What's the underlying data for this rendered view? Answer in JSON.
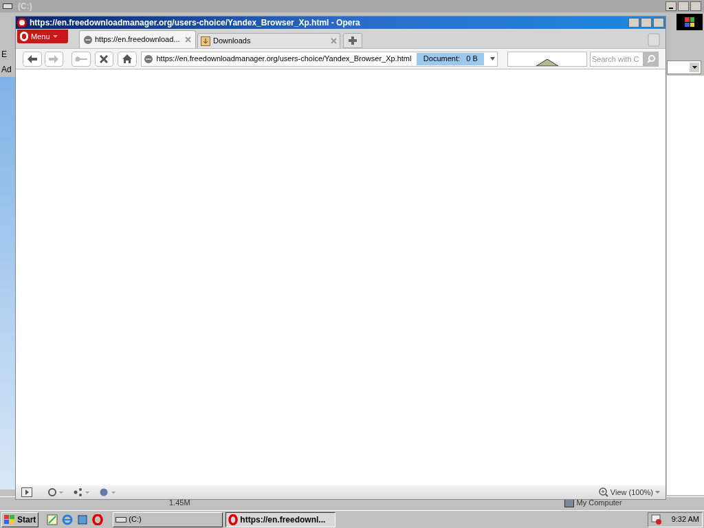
{
  "background_window": {
    "title": "(C:)",
    "side_texts": [
      "E",
      "Ad"
    ],
    "status_bar": [
      "1.45M",
      "My Computer"
    ]
  },
  "browser": {
    "title": "https://en.freedownloadmanager.org/users-choice/Yandex_Browser_Xp.html - Opera",
    "menu": "Menu",
    "tabs": [
      {
        "label": "https://en.freedownload...",
        "selected": true,
        "kind": "page"
      },
      {
        "label": "Downloads",
        "selected": false,
        "kind": "downloads"
      }
    ],
    "address": "https://en.freedownloadmanager.org/users-choice/Yandex_Browser_Xp.html",
    "progress": {
      "label": "Document:   0 B",
      "level": 1
    },
    "search": {
      "placeholder": "Search with C"
    },
    "zoom": "View (100%)"
  },
  "taskbar": {
    "start": "Start",
    "tasks": [
      {
        "label": "(C:)",
        "selected": false,
        "kind": "drive"
      },
      {
        "label": "https://en.freedownl...",
        "selected": true,
        "kind": "opera"
      }
    ],
    "clock": "9:32 AM"
  }
}
